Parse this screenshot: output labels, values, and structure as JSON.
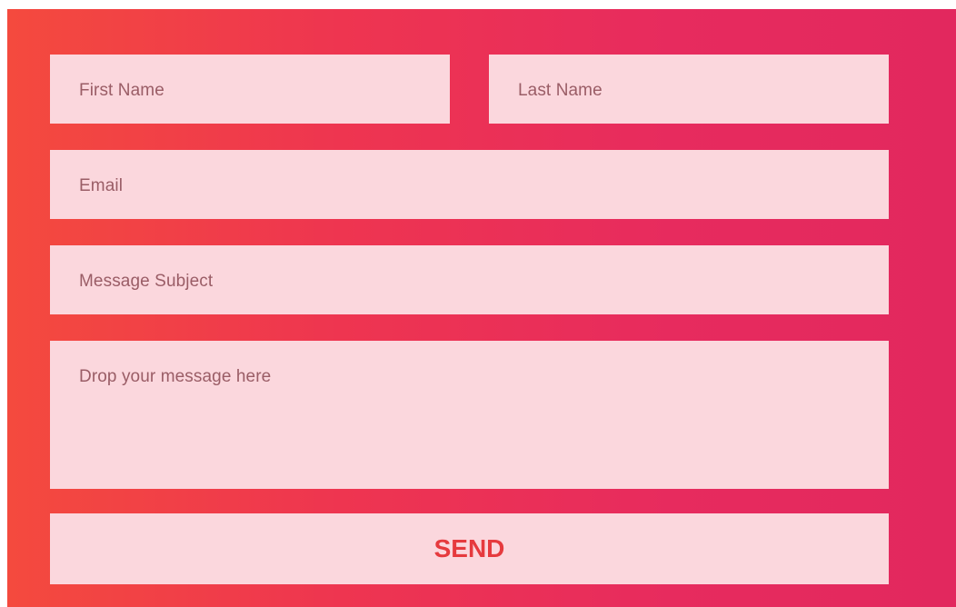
{
  "form": {
    "first_name": {
      "placeholder": "First Name",
      "value": ""
    },
    "last_name": {
      "placeholder": "Last Name",
      "value": ""
    },
    "email": {
      "placeholder": "Email",
      "value": ""
    },
    "subject": {
      "placeholder": "Message Subject",
      "value": ""
    },
    "message": {
      "placeholder": "Drop your message here",
      "value": ""
    },
    "send_label": "SEND"
  },
  "colors": {
    "gradient_left": "#f44a3e",
    "gradient_right": "#e2285e",
    "field_bg": "#fbd7dd",
    "send_text": "#e63a3e",
    "placeholder_text": "#9a5d66"
  }
}
